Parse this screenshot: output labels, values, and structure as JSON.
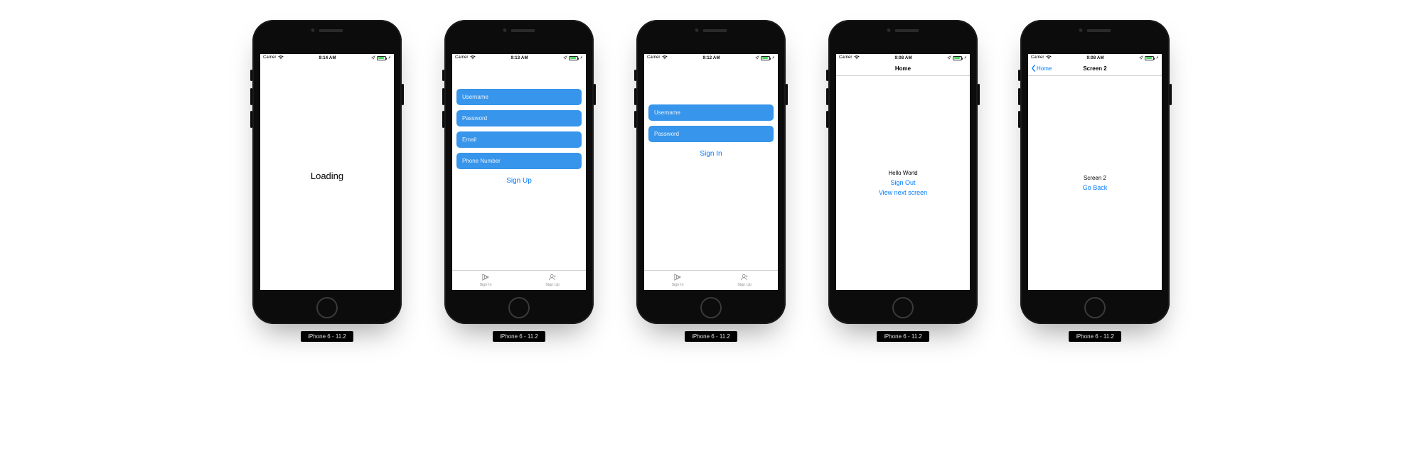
{
  "common": {
    "carrier": "Carrier",
    "device_caption": "iPhone 6 - 11.2"
  },
  "screens": [
    {
      "id": "loading",
      "time": "9:14 AM",
      "loading_text": "Loading"
    },
    {
      "id": "signup",
      "time": "9:13 AM",
      "fields": {
        "username": "Username",
        "password": "Password",
        "email": "Email",
        "phone": "Phone Number"
      },
      "submit_label": "Sign Up",
      "tabs": {
        "signin": "Sign In",
        "signup": "Sign Up"
      }
    },
    {
      "id": "signin",
      "time": "9:12 AM",
      "fields": {
        "username": "Username",
        "password": "Password"
      },
      "submit_label": "Sign In",
      "tabs": {
        "signin": "Sign In",
        "signup": "Sign Up"
      }
    },
    {
      "id": "home",
      "time": "9:08 AM",
      "nav_title": "Home",
      "hello": "Hello World",
      "signout_label": "Sign Out",
      "next_label": "View next screen"
    },
    {
      "id": "screen2",
      "time": "9:08 AM",
      "nav_title": "Screen 2",
      "back_label": "Home",
      "body_label": "Screen 2",
      "goback_label": "Go Back"
    }
  ]
}
